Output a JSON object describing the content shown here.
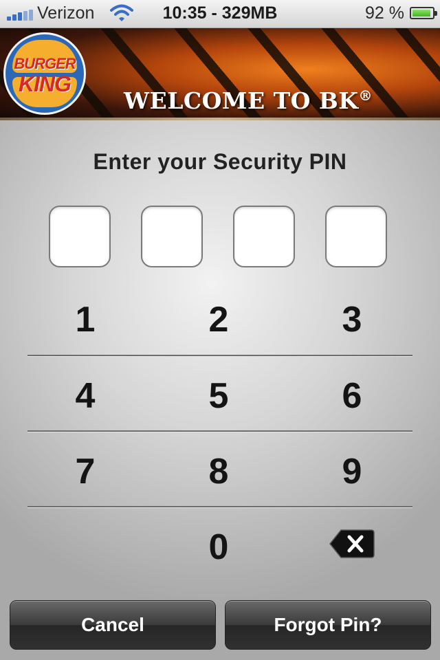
{
  "status_bar": {
    "carrier": "Verizon",
    "time_memory": "10:35 - 329MB",
    "battery_percent": "92 %",
    "battery_level": 0.92,
    "icons": [
      "signal-icon",
      "wifi-icon",
      "battery-icon"
    ]
  },
  "header": {
    "logo": {
      "line1": "BURGER",
      "line2": "KING"
    },
    "title": "WELCOME TO BK",
    "title_mark": "®"
  },
  "pin": {
    "prompt": "Enter your Security PIN",
    "digit_slots": [
      "",
      "",
      "",
      ""
    ]
  },
  "keypad": {
    "keys": [
      "1",
      "2",
      "3",
      "4",
      "5",
      "6",
      "7",
      "8",
      "9",
      "0"
    ],
    "backspace_icon": "backspace-icon"
  },
  "buttons": {
    "cancel": "Cancel",
    "forgot": "Forgot Pin?"
  },
  "colors": {
    "status_bar_bg": "#e4e4e4",
    "signal": "#3a6ec6",
    "battery": "#4cc223",
    "bk_red": "#d5282b",
    "bk_bun": "#f6ae2e",
    "bk_blue": "#2c68b8",
    "button_dark": "#333333"
  }
}
